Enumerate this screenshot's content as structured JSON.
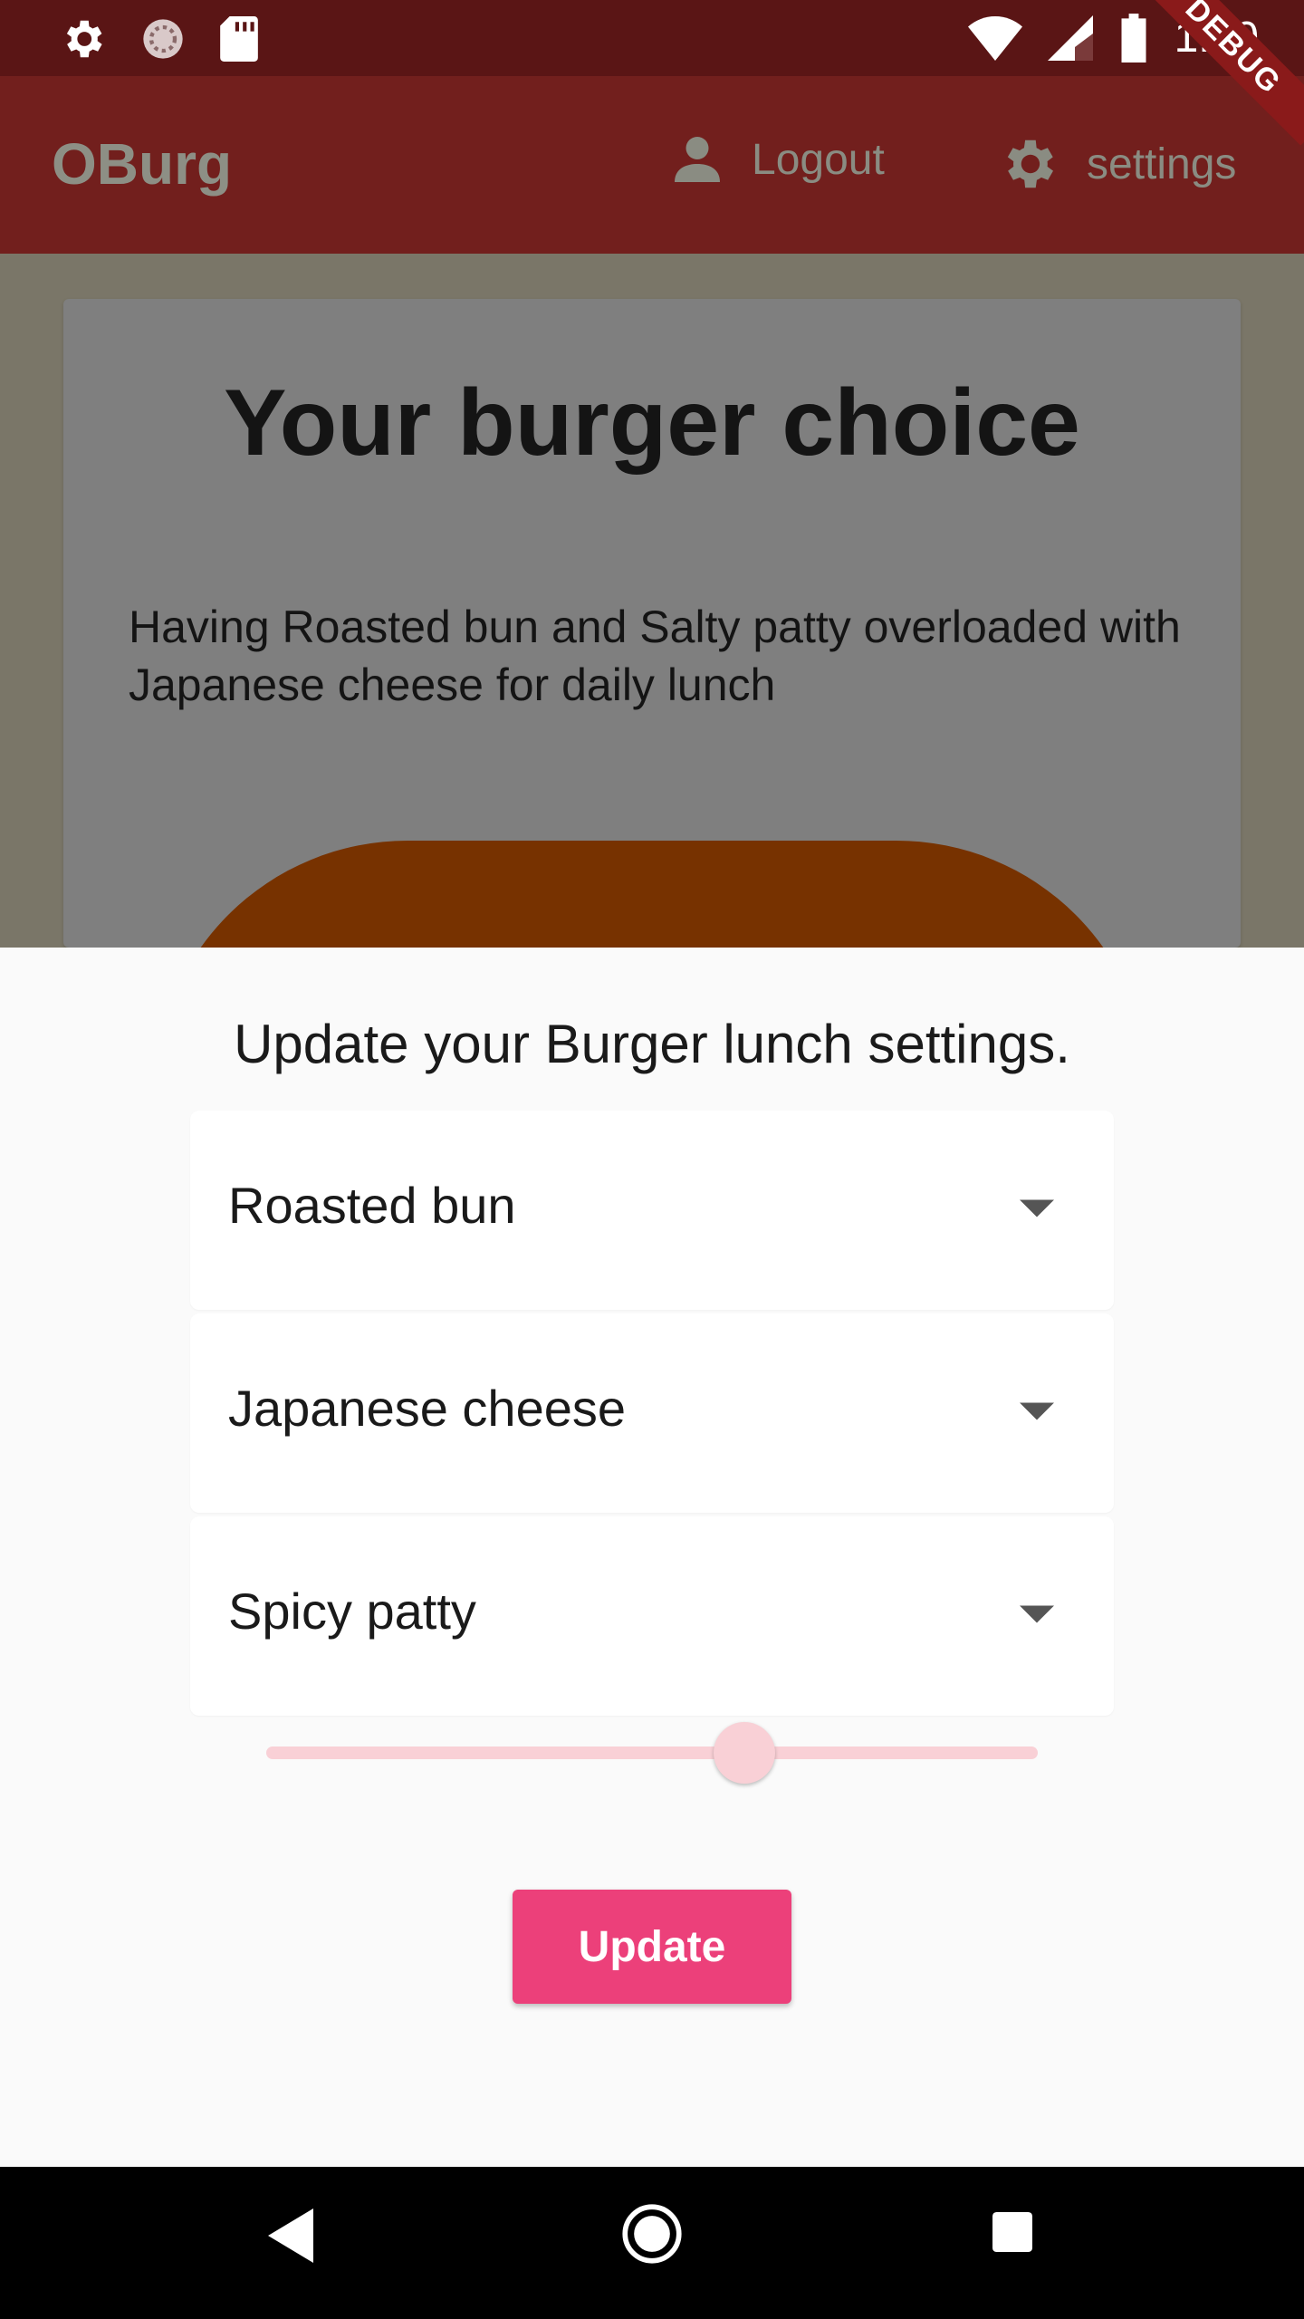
{
  "status_bar": {
    "time": "1:00",
    "icons": [
      "gear-icon",
      "loading-icon",
      "sd-card-icon",
      "wifi-icon",
      "signal-icon",
      "battery-icon"
    ]
  },
  "app_bar": {
    "title": "OBurg",
    "logout_label": "Logout",
    "settings_label": "settings",
    "debug_label": "DEBUG"
  },
  "card": {
    "title": "Your burger choice",
    "description": "Having Roasted bun  and Salty patty overloaded with Japanese cheese for daily lunch"
  },
  "sheet": {
    "title": "Update your Burger lunch settings.",
    "dropdowns": [
      {
        "value": "Roasted bun"
      },
      {
        "value": "Japanese cheese"
      },
      {
        "value": "Spicy patty"
      }
    ],
    "slider": {
      "value_fraction": 0.62
    },
    "update_label": "Update"
  },
  "colors": {
    "app_bar": "#721f1d",
    "accent": "#ec407a",
    "slider": "#f9d0d6",
    "bun": "#773200"
  }
}
